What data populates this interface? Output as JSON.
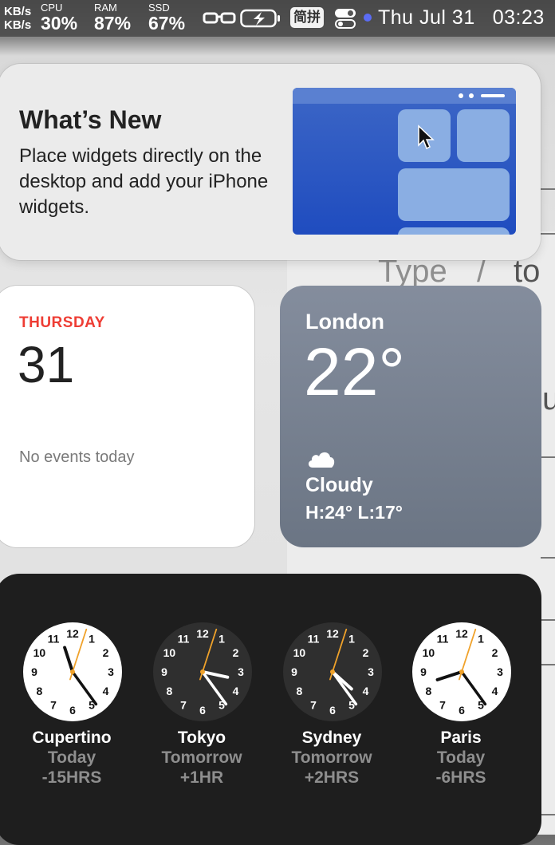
{
  "menubar": {
    "net_up": "KB/s",
    "net_down": "KB/s",
    "cpu_label": "CPU",
    "cpu_value": "30%",
    "ram_label": "RAM",
    "ram_value": "87%",
    "ssd_label": "SSD",
    "ssd_value": "67%",
    "input_method": "简拼",
    "date": "Thu Jul 31",
    "time": "03:23",
    "icons": [
      "glasses-icon",
      "battery-charging-icon",
      "control-center-icon",
      "siri-dot-icon"
    ]
  },
  "whats_new": {
    "title": "What’s New",
    "body": "Place widgets directly on the desktop and add your iPhone widgets."
  },
  "calendar": {
    "weekday": "THURSDAY",
    "day": "31",
    "events": "No events today"
  },
  "weather": {
    "city": "London",
    "temperature": "22°",
    "condition": "Cloudy",
    "high_low": "H:24° L:17°",
    "icon": "cloud-icon"
  },
  "world_clock": [
    {
      "city": "Cupertino",
      "day": "Today",
      "offset": "-15HRS",
      "hour": 11,
      "minute": 24,
      "second": 3,
      "face": "light"
    },
    {
      "city": "Tokyo",
      "day": "Tomorrow",
      "offset": "+1HR",
      "hour": 3,
      "minute": 24,
      "second": 3,
      "face": "dark"
    },
    {
      "city": "Sydney",
      "day": "Tomorrow",
      "offset": "+2HRS",
      "hour": 4,
      "minute": 24,
      "second": 3,
      "face": "dark"
    },
    {
      "city": "Paris",
      "day": "Today",
      "offset": "-6HRS",
      "hour": 20,
      "minute": 24,
      "second": 3,
      "face": "light"
    }
  ],
  "background_text": {
    "type_hint": "Type",
    "slash": "/",
    "to": "to",
    "u": "u"
  },
  "colors": {
    "accent_red": "#ee3d34",
    "second_hand": "#f0a22a",
    "weather_bg": "#7a8494",
    "clock_panel": "#1e1e1e"
  }
}
